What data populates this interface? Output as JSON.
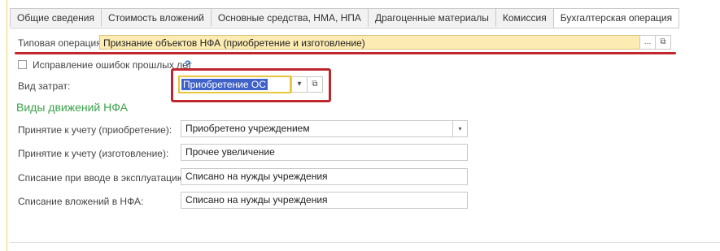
{
  "tabs": [
    {
      "label": "Общие сведения"
    },
    {
      "label": "Стоимость вложений"
    },
    {
      "label": "Основные средства, НМА, НПА"
    },
    {
      "label": "Драгоценные материалы"
    },
    {
      "label": "Комиссия"
    },
    {
      "label": "Бухгалтерская операция"
    }
  ],
  "active_tab": "Бухгалтерская операция",
  "typical_operation": {
    "label": "Типовая операция:",
    "value": "Признание объектов НФА (приобретение и изготовление)",
    "select_button": "...",
    "open_button": "⧉"
  },
  "error_correction": {
    "label": "Исправление ошибок прошлых лет",
    "checked": false,
    "help": "?"
  },
  "cost_type": {
    "label": "Вид затрат:",
    "value": "Приобретение ОС",
    "dropdown_button": "▾",
    "open_button": "⧉"
  },
  "section_title": "Виды движений НФА",
  "movements": [
    {
      "label": "Принятие к учету (приобретение):",
      "value": "Приобретено учреждением"
    },
    {
      "label": "Принятие к учету (изготовление):",
      "value": "Прочее увеличение"
    },
    {
      "label": "Списание при вводе в эксплуатацию:",
      "value": "Списано на нужды учреждения"
    },
    {
      "label": "Списание вложений в НФА:",
      "value": "Списано на нужды учреждения"
    }
  ],
  "colors": {
    "highlight_field": "#fcebb2",
    "annotation_red": "#c0272d",
    "section_green": "#3aa34a",
    "selection_blue": "#3f62c9"
  }
}
